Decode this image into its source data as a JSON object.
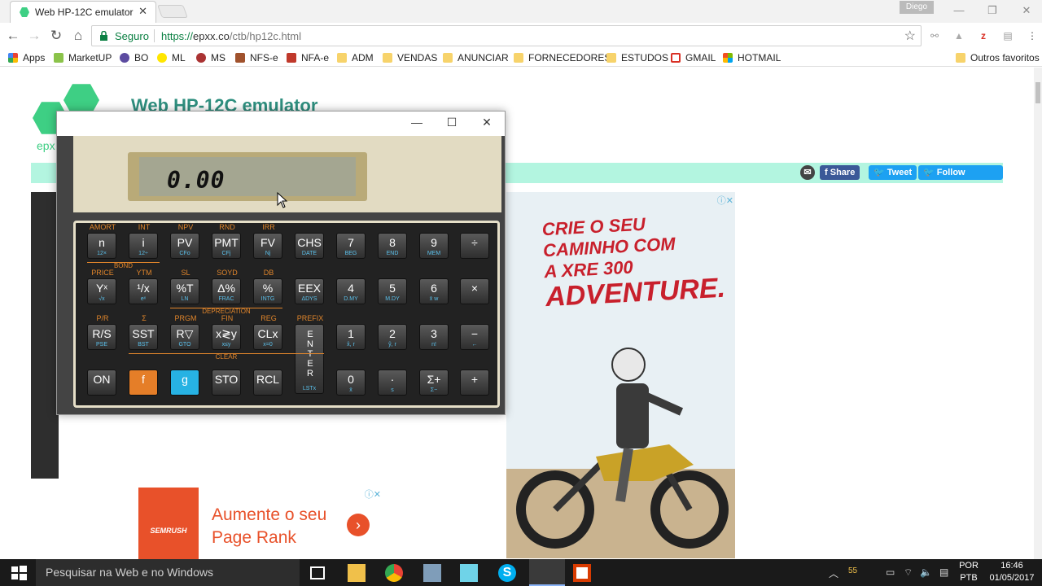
{
  "browser": {
    "tab_title": "Web HP-12C emulator",
    "profile": "Diego",
    "secure_label": "Seguro",
    "url_proto": "https://",
    "url_host": "epxx.co",
    "url_path": "/ctb/hp12c.html"
  },
  "bookmarks": [
    {
      "label": "Apps",
      "icon": "apps-grid"
    },
    {
      "label": "MarketUP",
      "icon": "marketup"
    },
    {
      "label": "BO",
      "icon": "bo"
    },
    {
      "label": "ML",
      "icon": "ml"
    },
    {
      "label": "MS",
      "icon": "ms"
    },
    {
      "label": "NFS-e",
      "icon": "nfse"
    },
    {
      "label": "NFA-e",
      "icon": "nfae"
    },
    {
      "label": "ADM",
      "icon": "folder"
    },
    {
      "label": "VENDAS",
      "icon": "folder"
    },
    {
      "label": "ANUNCIAR",
      "icon": "folder"
    },
    {
      "label": "FORNECEDORES",
      "icon": "folder"
    },
    {
      "label": "ESTUDOS",
      "icon": "folder"
    },
    {
      "label": "GMAIL",
      "icon": "gmail"
    },
    {
      "label": "HOTMAIL",
      "icon": "windows-logo"
    },
    {
      "label": "Outros favoritos",
      "icon": "folder"
    }
  ],
  "site": {
    "title": "Web HP-12C emulator",
    "logo_text": "epx",
    "share": {
      "share": "Share",
      "tweet": "Tweet",
      "follow": "Follow @epx__"
    }
  },
  "calculator": {
    "display": "0.00",
    "group_labels": {
      "bond": "BOND",
      "depreciation": "DEPRECIATION",
      "clear": "CLEAR"
    },
    "rows": [
      [
        {
          "main": "n",
          "sub": "12×",
          "top": "AMORT"
        },
        {
          "main": "i",
          "sub": "12÷",
          "top": "INT"
        },
        {
          "main": "PV",
          "sub": "CFo",
          "top": "NPV"
        },
        {
          "main": "PMT",
          "sub": "CFj",
          "top": "RND"
        },
        {
          "main": "FV",
          "sub": "Nj",
          "top": "IRR"
        },
        {
          "main": "CHS",
          "sub": "DATE",
          "top": ""
        },
        {
          "main": "7",
          "sub": "BEG",
          "top": ""
        },
        {
          "main": "8",
          "sub": "END",
          "top": ""
        },
        {
          "main": "9",
          "sub": "MEM",
          "top": ""
        },
        {
          "main": "÷",
          "sub": "",
          "top": ""
        }
      ],
      [
        {
          "main": "Yˣ",
          "sub": "√x",
          "top": "PRICE"
        },
        {
          "main": "¹/x",
          "sub": "eˣ",
          "top": "YTM"
        },
        {
          "main": "%T",
          "sub": "LN",
          "top": "SL"
        },
        {
          "main": "Δ%",
          "sub": "FRAC",
          "top": "SOYD"
        },
        {
          "main": "%",
          "sub": "INTG",
          "top": "DB"
        },
        {
          "main": "EEX",
          "sub": "ΔDYS",
          "top": ""
        },
        {
          "main": "4",
          "sub": "D.MY",
          "top": ""
        },
        {
          "main": "5",
          "sub": "M.DY",
          "top": ""
        },
        {
          "main": "6",
          "sub": "x̄ w",
          "top": ""
        },
        {
          "main": "×",
          "sub": "",
          "top": ""
        }
      ],
      [
        {
          "main": "R/S",
          "sub": "PSE",
          "top": "P/R"
        },
        {
          "main": "SST",
          "sub": "BST",
          "top": "Σ"
        },
        {
          "main": "R▽",
          "sub": "GTO",
          "top": "PRGM"
        },
        {
          "main": "x≷y",
          "sub": "x≤y",
          "top": "FIN"
        },
        {
          "main": "CLx",
          "sub": "x=0",
          "top": "REG"
        },
        {
          "main": "ENTER",
          "sub": "LSTx",
          "top": "PREFIX"
        },
        {
          "main": "1",
          "sub": "x̂, r",
          "top": ""
        },
        {
          "main": "2",
          "sub": "ŷ, r",
          "top": ""
        },
        {
          "main": "3",
          "sub": "n!",
          "top": ""
        },
        {
          "main": "−",
          "sub": "←",
          "top": ""
        }
      ],
      [
        {
          "main": "ON",
          "sub": "",
          "top": ""
        },
        {
          "main": "f",
          "sub": "",
          "top": ""
        },
        {
          "main": "g",
          "sub": "",
          "top": ""
        },
        {
          "main": "STO",
          "sub": "",
          "top": ""
        },
        {
          "main": "RCL",
          "sub": "",
          "top": ""
        },
        {
          "main": "0",
          "sub": "x̄",
          "top": ""
        },
        {
          "main": "·",
          "sub": "s",
          "top": ""
        },
        {
          "main": "Σ+",
          "sub": "Σ−",
          "top": ""
        },
        {
          "main": "+",
          "sub": "",
          "top": ""
        }
      ]
    ]
  },
  "ads": {
    "moto": {
      "l1": "CRIE O SEU",
      "l2": "CAMINHO COM",
      "l3": "A XRE 300",
      "l4": "ADVENTURE."
    },
    "semrush": {
      "brand": "SEMRUSH",
      "line1": "Aumente o seu",
      "line2": "Page Rank"
    }
  },
  "taskbar": {
    "search_placeholder": "Pesquisar na Web e no Windows",
    "lang_top": "POR",
    "lang_bottom": "PTB",
    "time": "16:46",
    "date": "01/05/2017",
    "tray_number": "55"
  }
}
